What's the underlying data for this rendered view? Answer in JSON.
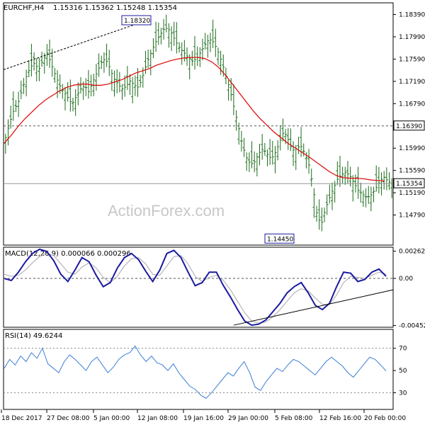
{
  "header": {
    "symbol": "EURCHF,H4",
    "ohlc": "1.15316 1.15362 1.15248 1.15354"
  },
  "watermark": "ActionForex.com",
  "colors": {
    "bars": "#1a6b1a",
    "ma": "#e00000",
    "macd": "#1a1aa0",
    "signal": "#a8a8a8",
    "rsi": "#3b7fd6",
    "grid_dash": "#555555",
    "trend": "#000000"
  },
  "chart_data": [
    {
      "type": "ohlc",
      "title": "EURCHF,H4",
      "y_ticks": [
        "1.18390",
        "1.17990",
        "1.17590",
        "1.17190",
        "1.16790",
        "1.16390",
        "1.15990",
        "1.15590",
        "1.15190",
        "1.14790"
      ],
      "ylim": [
        1.1425,
        1.186
      ],
      "x_ticks": [
        "18 Dec 2017",
        "27 Dec 08:00",
        "5 Jan 00:00",
        "12 Jan 08:00",
        "19 Jan 16:00",
        "29 Jan 00:00",
        "5 Feb 08:00",
        "12 Feb 16:00",
        "20 Feb 00:00"
      ],
      "close_path": [
        1.1618,
        1.1645,
        1.1668,
        1.168,
        1.1705,
        1.1728,
        1.1745,
        1.1752,
        1.174,
        1.1758,
        1.177,
        1.175,
        1.173,
        1.1712,
        1.17,
        1.169,
        1.1678,
        1.1692,
        1.1705,
        1.1712,
        1.17,
        1.1718,
        1.1735,
        1.1752,
        1.176,
        1.1745,
        1.1725,
        1.1715,
        1.1705,
        1.171,
        1.172,
        1.1712,
        1.1708,
        1.1728,
        1.1752,
        1.177,
        1.1788,
        1.18,
        1.1812,
        1.1815,
        1.1805,
        1.179,
        1.1778,
        1.177,
        1.1762,
        1.1755,
        1.176,
        1.1772,
        1.1785,
        1.1795,
        1.179,
        1.1775,
        1.1755,
        1.173,
        1.1705,
        1.1672,
        1.164,
        1.1605,
        1.1582,
        1.157,
        1.1575,
        1.159,
        1.1598,
        1.1588,
        1.158,
        1.1592,
        1.161,
        1.163,
        1.1615,
        1.1595,
        1.1598,
        1.1604,
        1.159,
        1.157,
        1.153,
        1.1478,
        1.1462,
        1.149,
        1.151,
        1.1528,
        1.1545,
        1.1552,
        1.1556,
        1.1548,
        1.1535,
        1.1522,
        1.1516,
        1.151,
        1.1515,
        1.1525,
        1.1538,
        1.1548,
        1.154,
        1.1535
      ],
      "ma_path": [
        1.1608,
        1.1622,
        1.1638,
        1.1652,
        1.1664,
        1.1676,
        1.1686,
        1.1694,
        1.1702,
        1.1708,
        1.1712,
        1.1714,
        1.1714,
        1.1712,
        1.1712,
        1.1714,
        1.1718,
        1.1722,
        1.1728,
        1.1734,
        1.1738,
        1.1742,
        1.1748,
        1.1752,
        1.1756,
        1.1759,
        1.1761,
        1.1762,
        1.1762,
        1.176,
        1.1754,
        1.1744,
        1.173,
        1.1714,
        1.1698,
        1.1682,
        1.1666,
        1.1652,
        1.164,
        1.1628,
        1.1618,
        1.1608,
        1.16,
        1.1592,
        1.1584,
        1.1575,
        1.1566,
        1.1557,
        1.155,
        1.1546,
        1.1545,
        1.1545,
        1.1544,
        1.1542,
        1.1541,
        1.154
      ],
      "annotations": [
        {
          "label": "1.18320",
          "value": 1.1832
        },
        {
          "label": "1.14450",
          "value": 1.1445
        },
        {
          "label": "1.16390",
          "value": 1.1639,
          "style": "dashed-level"
        },
        {
          "label": "1.15354",
          "value": 1.15354,
          "style": "current-price"
        }
      ]
    },
    {
      "type": "line",
      "title": "MACD(12,26,9) 0.000066 0.000296",
      "y_ticks": [
        "0.00262",
        "0.00",
        "-0.004526"
      ],
      "ylim": [
        -0.0047,
        0.003
      ],
      "series": [
        {
          "name": "MACD",
          "values": [
            0.0,
            -0.0002,
            0.0006,
            0.0016,
            0.0024,
            0.0028,
            0.0026,
            0.0017,
            0.0004,
            -0.0003,
            0.0008,
            0.002,
            0.0016,
            0.0003,
            -0.0008,
            -0.0004,
            0.001,
            0.002,
            0.0024,
            0.0018,
            0.0007,
            -0.0003,
            0.0008,
            0.0024,
            0.0027,
            0.002,
            0.0006,
            -0.0007,
            -0.0004,
            0.0006,
            0.0006,
            -0.0007,
            -0.0018,
            -0.003,
            -0.0041,
            -0.0045,
            -0.0044,
            -0.004,
            -0.0032,
            -0.0024,
            -0.0014,
            -0.0008,
            -0.0004,
            -0.0014,
            -0.0026,
            -0.003,
            -0.0024,
            -0.0008,
            0.0006,
            0.0005,
            -0.0003,
            -0.0001,
            0.0006,
            0.0009,
            0.0002
          ]
        },
        {
          "name": "Signal",
          "values": [
            0.0004,
            0.0002,
            0.0003,
            0.0008,
            0.0015,
            0.0021,
            0.0024,
            0.0022,
            0.0014,
            0.0006,
            0.0004,
            0.0011,
            0.0015,
            0.001,
            0.0001,
            -0.0004,
            0.0002,
            0.0012,
            0.0019,
            0.002,
            0.0014,
            0.0004,
            0.0003,
            0.0012,
            0.0021,
            0.0022,
            0.0014,
            0.0002,
            -0.0003,
            0.0001,
            0.0003,
            -0.0002,
            -0.0011,
            -0.0022,
            -0.0033,
            -0.0041,
            -0.0043,
            -0.0042,
            -0.0037,
            -0.003,
            -0.0022,
            -0.0014,
            -0.001,
            -0.0012,
            -0.0019,
            -0.0025,
            -0.0025,
            -0.0016,
            -0.0004,
            0.0002,
            0.0001,
            0.0,
            0.0003,
            0.0006,
            0.0004
          ]
        }
      ],
      "trendline": [
        [
          -0.0045,
          0.0
        ]
      ]
    },
    {
      "type": "line",
      "title": "RSI(14) 49.6244",
      "y_ticks": [
        "70",
        "50",
        "30"
      ],
      "ylim": [
        15,
        87
      ],
      "levels": [
        70,
        30
      ],
      "series": [
        {
          "name": "RSI",
          "values": [
            52,
            60,
            55,
            63,
            58,
            66,
            61,
            70,
            56,
            52,
            48,
            58,
            64,
            60,
            55,
            50,
            58,
            62,
            55,
            48,
            53,
            60,
            64,
            66,
            72,
            64,
            58,
            63,
            57,
            55,
            50,
            56,
            48,
            42,
            36,
            33,
            28,
            25,
            30,
            36,
            42,
            48,
            45,
            52,
            58,
            48,
            35,
            32,
            40,
            46,
            52,
            49,
            55,
            60,
            58,
            54,
            50,
            46,
            52,
            58,
            62,
            58,
            54,
            48,
            44,
            50,
            56,
            62,
            60,
            55,
            49.6
          ]
        }
      ]
    }
  ]
}
